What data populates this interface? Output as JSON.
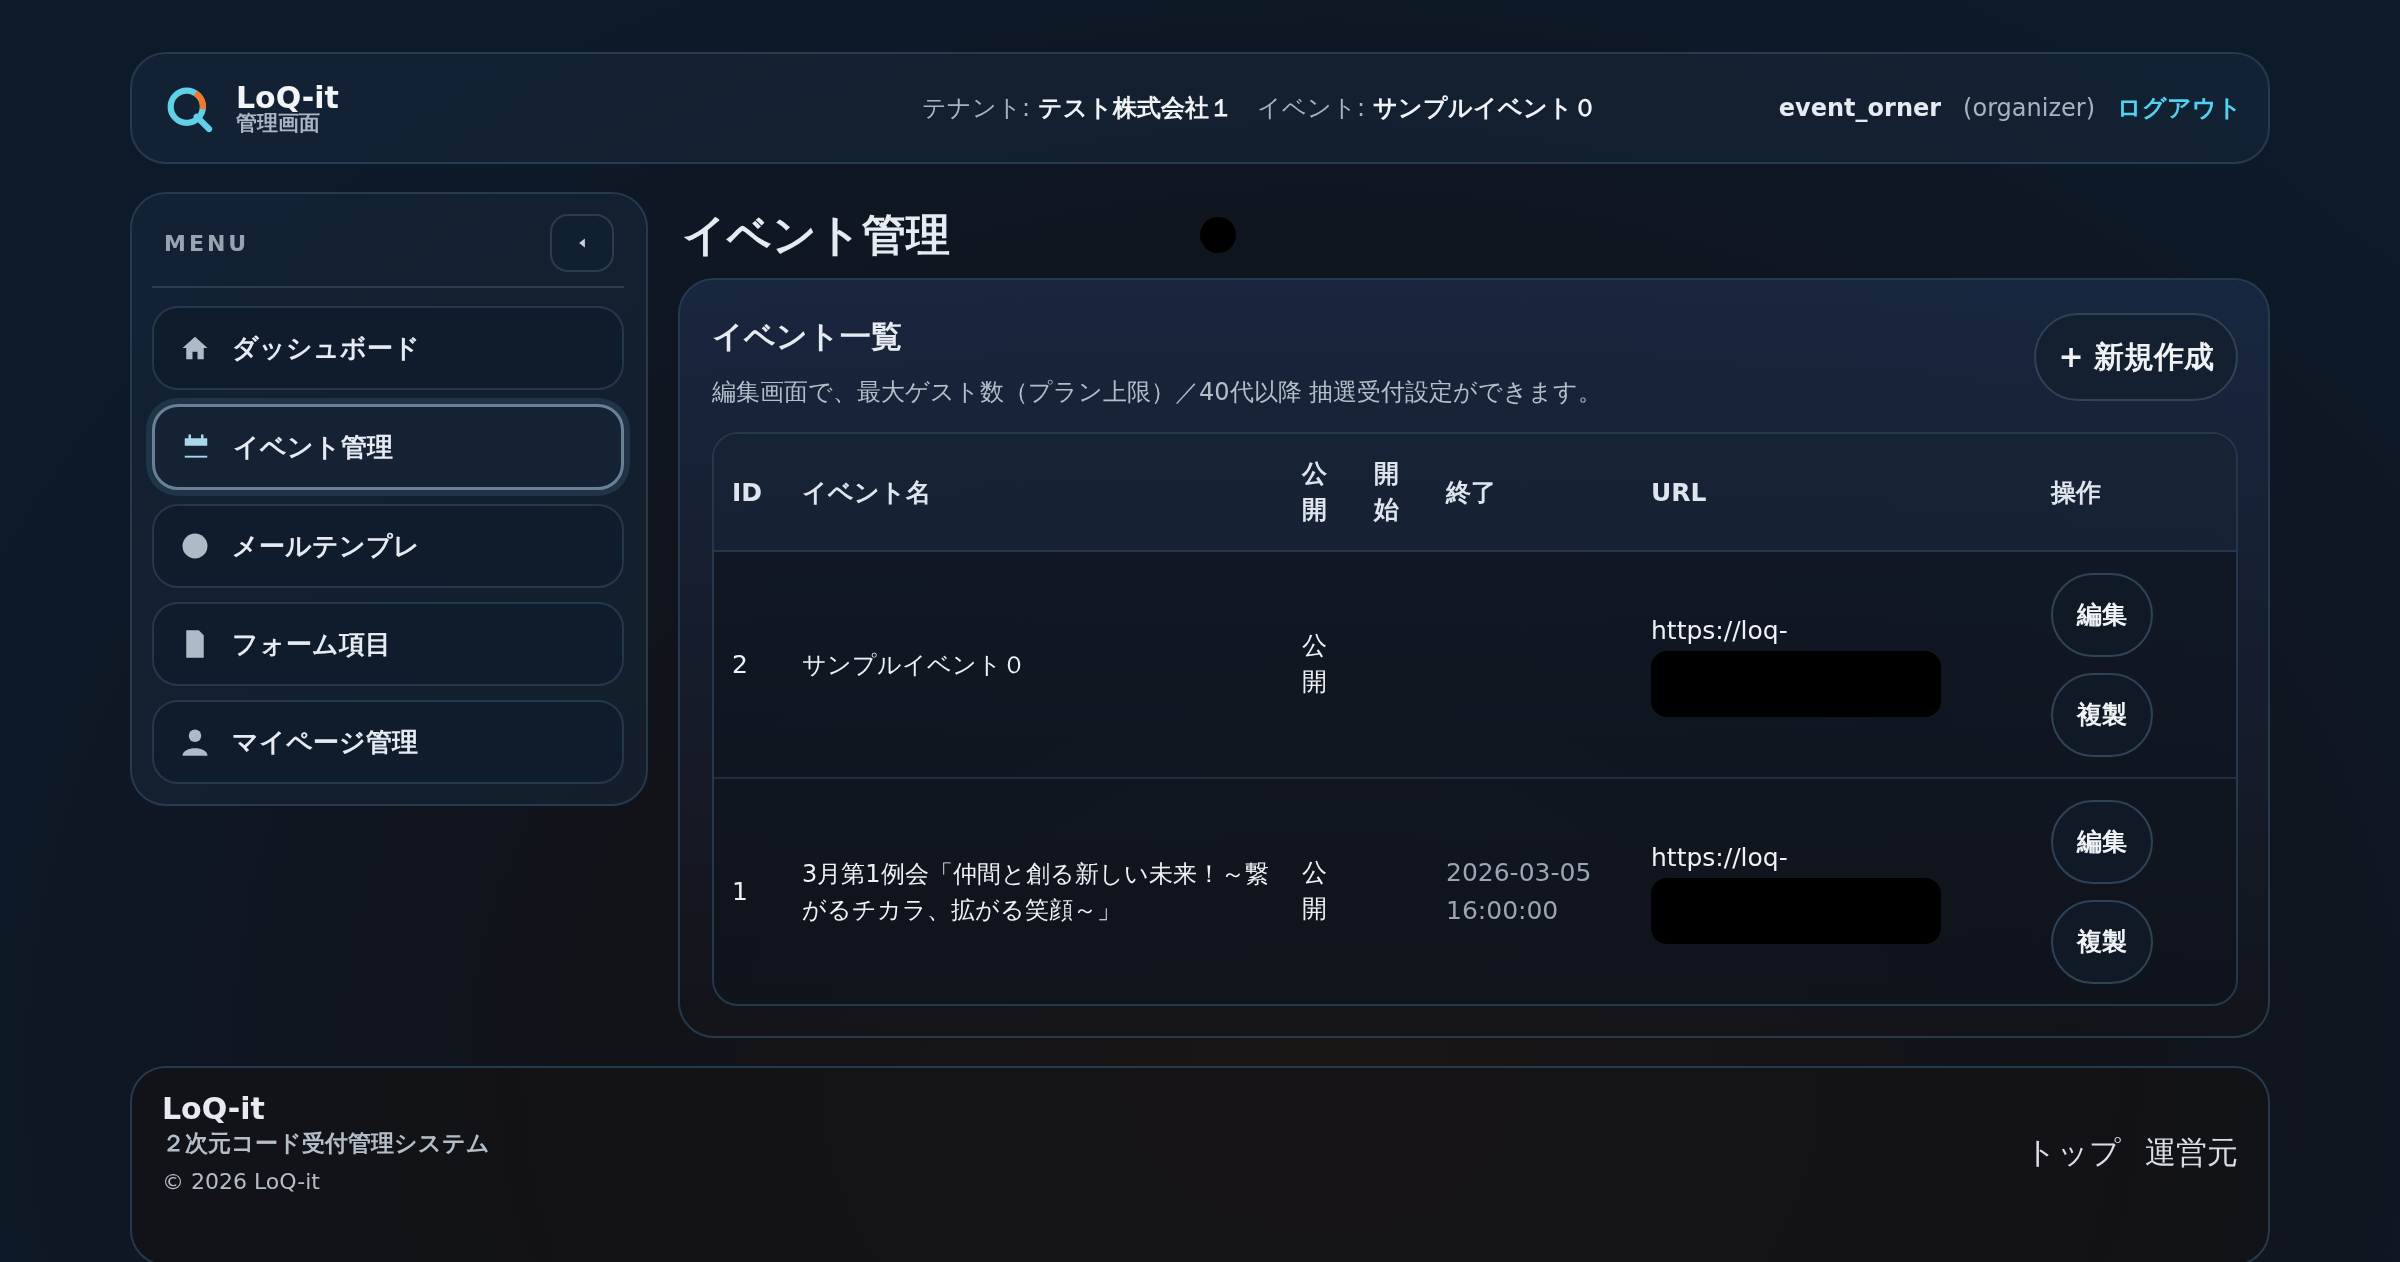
{
  "header": {
    "logo": {
      "name": "LoQ-it",
      "subtitle": "管理画面"
    },
    "context": [
      {
        "label": "テナント:",
        "value": "テスト株式会社１"
      },
      {
        "label": "イベント:",
        "value": "サンプルイベント０"
      }
    ],
    "user": "event_orner",
    "role": "(organizer)",
    "logout": "ログアウト"
  },
  "sidebar": {
    "heading": "MENU",
    "items": [
      {
        "label": "ダッシュボード",
        "selected": false
      },
      {
        "label": "イベント管理",
        "selected": true
      },
      {
        "label": "メールテンプレ",
        "selected": false
      },
      {
        "label": "フォーム項目",
        "selected": false
      },
      {
        "label": "マイページ管理",
        "selected": false
      }
    ]
  },
  "page_title": "イベント管理",
  "panel": {
    "title": "イベント一覧",
    "note": "編集画面で、最大ゲスト数（プラン上限）／40代以降 抽選受付設定ができます。",
    "new_button": "+ 新規作成",
    "table": {
      "columns": [
        "ID",
        "イベント名",
        "公開",
        "開始",
        "終了",
        "URL",
        "操作"
      ],
      "rows": [
        {
          "id": "2",
          "name": "サンプルイベント０",
          "published": "公開",
          "url": "https://loq-",
          "actions": [
            "編集",
            "複製"
          ]
        },
        {
          "id": "1",
          "name": "3月第1例会「仲間と創る新しい未来！～繋がるチカラ、拡がる笑顔～」",
          "published": "公開",
          "end": "2026-03-05 16:00:00",
          "url": "https://loq-",
          "actions": [
            "編集",
            "複製"
          ]
        }
      ]
    }
  },
  "footer": {
    "brand": "LoQ-it",
    "tagline": "２次元コード受付管理システム",
    "copyright": "© 2026 LoQ-it",
    "links": [
      "トップ",
      "運営元"
    ]
  }
}
